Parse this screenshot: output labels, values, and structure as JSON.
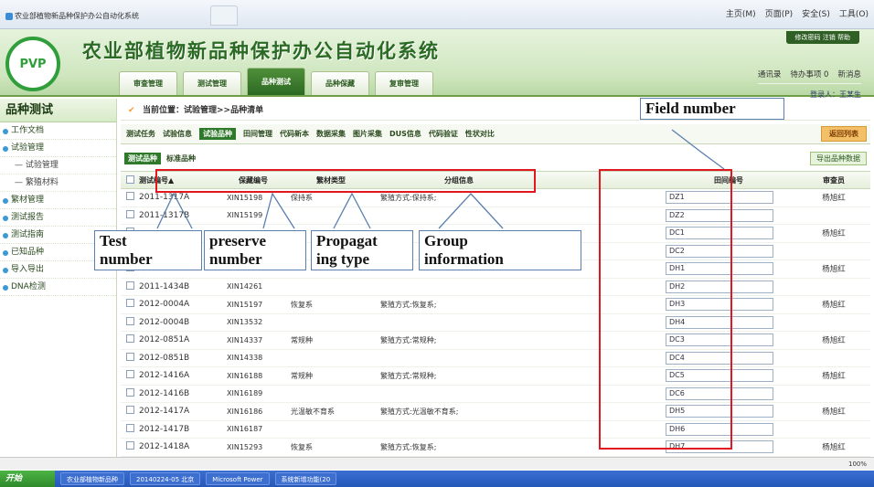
{
  "browser": {
    "tab_title": "农业部植物新品种保护办公自动化系统",
    "tools": [
      "主页(M)",
      "页面(P)",
      "安全(S)",
      "工具(O)"
    ]
  },
  "app": {
    "logo_text": "PVP",
    "title": "农业部植物新品种保护办公自动化系统",
    "top_links": "修改密码  注销  帮助",
    "main_tabs": [
      "审查管理",
      "测试管理",
      "品种测试",
      "品种保藏",
      "复审管理"
    ],
    "active_main_tab": "品种测试",
    "header_right": {
      "links": [
        "通讯录",
        "待办事项 0",
        "新消息"
      ],
      "user": "登录人：王某生"
    }
  },
  "sidebar": {
    "title": "品种测试",
    "items": [
      "工作文档",
      "试验管理",
      "— 试验管理",
      "— 繁殖材料",
      "繁材管理",
      "测试报告",
      "测试指南",
      "已知品种",
      "导入导出",
      "DNA检测"
    ]
  },
  "breadcrumb": "当前位置：试验管理>>品种清单",
  "subtabs": {
    "items": [
      "测试任务",
      "试验信息",
      "试验品种",
      "田间管理",
      "代码新本",
      "数据采集",
      "图片采集",
      "DUS信息",
      "代码验证",
      "性状对比"
    ],
    "active": "试验品种",
    "right_button": "返回列表"
  },
  "lowtabs": {
    "items": [
      "测试品种",
      "标准品种"
    ],
    "active": "测试品种",
    "right_button": "导出品种数据"
  },
  "table": {
    "headers": {
      "test": "测试编号▲",
      "preserve": "保藏编号",
      "propagation": "繁材类型",
      "group": "分组信息",
      "field": "田间编号",
      "reviewer": "审查员"
    },
    "rows": [
      {
        "test": "2011-1317A",
        "preserve": "XIN15198",
        "prop": "保持系",
        "group": "繁殖方式:保持系;",
        "field": "DZ1",
        "rev": "杨旭红"
      },
      {
        "test": "2011-1317B",
        "preserve": "XIN15199",
        "prop": "",
        "group": "",
        "field": "DZ2",
        "rev": ""
      },
      {
        "test": "",
        "preserve": "",
        "prop": "",
        "group": "",
        "field": "DC1",
        "rev": "杨旭红"
      },
      {
        "test": "",
        "preserve": "",
        "prop": "",
        "group": "",
        "field": "DC2",
        "rev": ""
      },
      {
        "test": "",
        "preserve": "",
        "prop": "",
        "group": "",
        "field": "DH1",
        "rev": "杨旭红"
      },
      {
        "test": "2011-1434B",
        "preserve": "XIN14261",
        "prop": "",
        "group": "",
        "field": "DH2",
        "rev": ""
      },
      {
        "test": "2012-0004A",
        "preserve": "XIN15197",
        "prop": "恢复系",
        "group": "繁殖方式:恢复系;",
        "field": "DH3",
        "rev": "杨旭红"
      },
      {
        "test": "2012-0004B",
        "preserve": "XIN13532",
        "prop": "",
        "group": "",
        "field": "DH4",
        "rev": ""
      },
      {
        "test": "2012-0851A",
        "preserve": "XIN14337",
        "prop": "常规种",
        "group": "繁殖方式:常规种;",
        "field": "DC3",
        "rev": "杨旭红"
      },
      {
        "test": "2012-0851B",
        "preserve": "XIN14338",
        "prop": "",
        "group": "",
        "field": "DC4",
        "rev": ""
      },
      {
        "test": "2012-1416A",
        "preserve": "XIN16188",
        "prop": "常规种",
        "group": "繁殖方式:常规种;",
        "field": "DC5",
        "rev": "杨旭红"
      },
      {
        "test": "2012-1416B",
        "preserve": "XIN16189",
        "prop": "",
        "group": "",
        "field": "DC6",
        "rev": ""
      },
      {
        "test": "2012-1417A",
        "preserve": "XIN16186",
        "prop": "光温敏不育系",
        "group": "繁殖方式:光温敏不育系;",
        "field": "DH5",
        "rev": "杨旭红"
      },
      {
        "test": "2012-1417B",
        "preserve": "XIN16187",
        "prop": "",
        "group": "",
        "field": "DH6",
        "rev": ""
      },
      {
        "test": "2012-1418A",
        "preserve": "XIN15293",
        "prop": "恢复系",
        "group": "繁殖方式:恢复系;",
        "field": "DH7",
        "rev": "杨旭红"
      }
    ]
  },
  "annotations": {
    "field_number": "Field number",
    "test_number_1": "Test",
    "test_number_2": "number",
    "preserve_1": "preserve",
    "preserve_2": "number",
    "propagating_1": "Propagat",
    "propagating_2": "ing type",
    "group_1": "Group",
    "group_2": "information"
  },
  "statusbar": "100%",
  "taskbar": {
    "start": "开始",
    "tasks": [
      "农业部植物新品种",
      "20140224-05 北京",
      "Microsoft Power",
      "系统新增功能(20"
    ]
  },
  "colors": {
    "annotation_red": "#e2171f",
    "header_green": "#2f9e3b",
    "active_tab": "#2c6a22"
  }
}
